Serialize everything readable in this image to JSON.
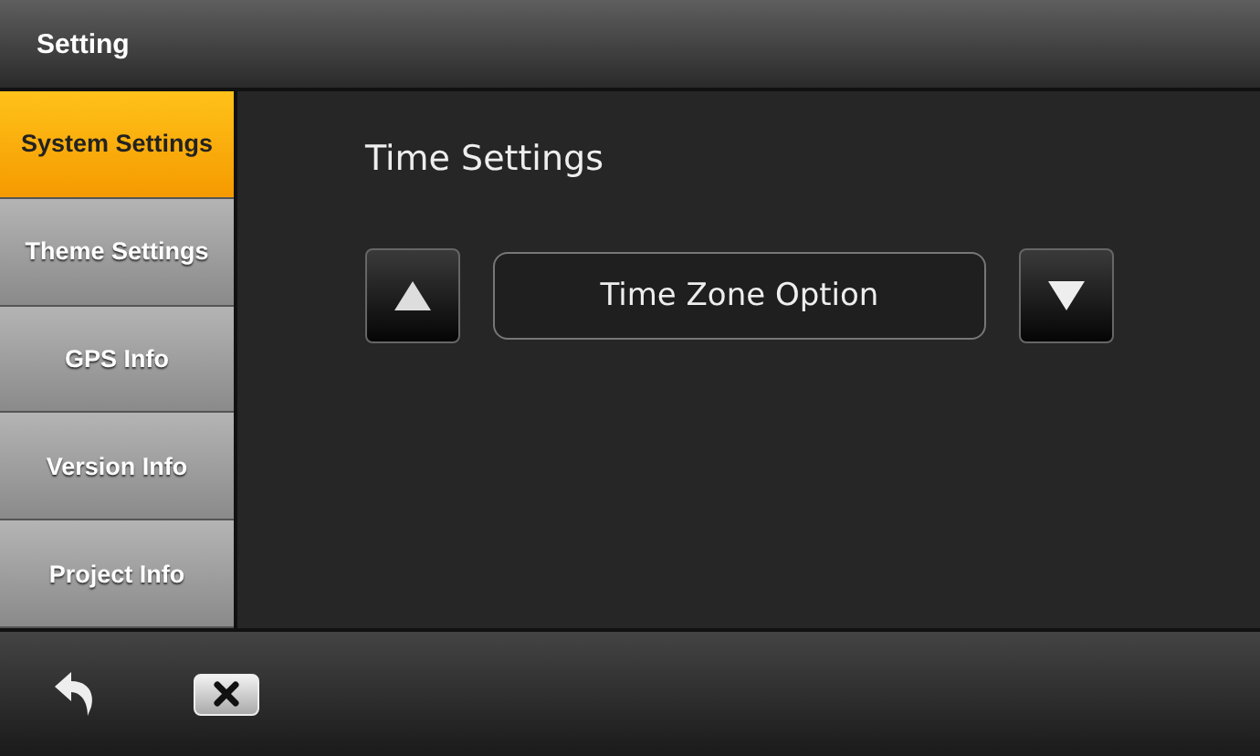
{
  "window": {
    "title": "Setting"
  },
  "sidebar": {
    "items": [
      {
        "label": "System Settings",
        "selected": true
      },
      {
        "label": "Theme Settings",
        "selected": false
      },
      {
        "label": "GPS Info",
        "selected": false
      },
      {
        "label": "Version Info",
        "selected": false
      },
      {
        "label": "Project Info",
        "selected": false
      }
    ]
  },
  "content": {
    "heading": "Time Settings",
    "option": "Time Zone Option"
  }
}
